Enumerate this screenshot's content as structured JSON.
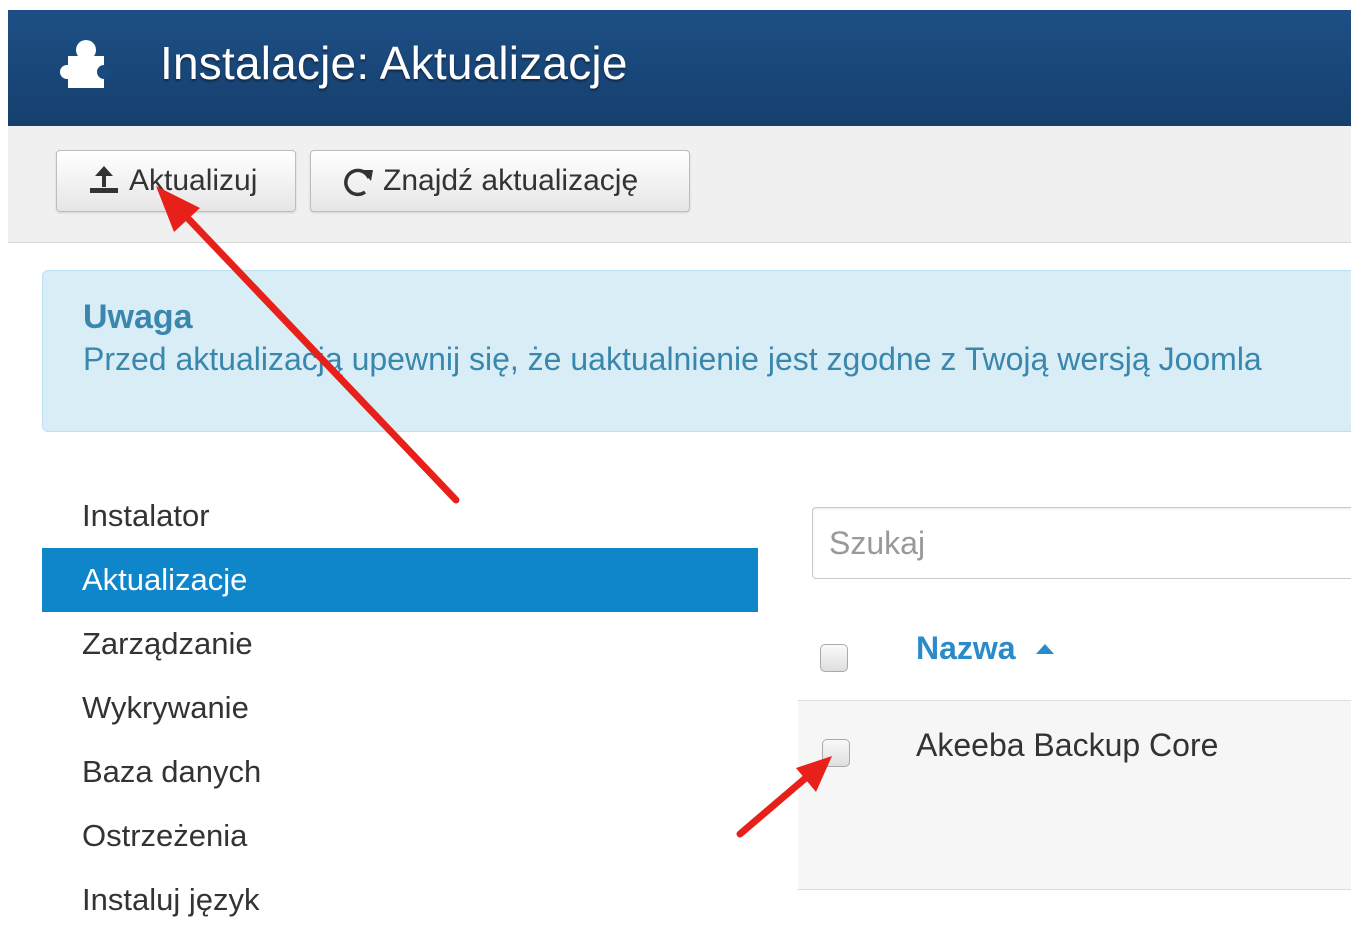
{
  "header": {
    "title": "Instalacje: Aktualizacje",
    "icon": "puzzle-icon",
    "background": "#1a4a7e"
  },
  "toolbar": {
    "update_label": "Aktualizuj",
    "update_icon": "upload-icon",
    "find_label": "Znajdź aktualizację",
    "find_icon": "refresh-icon"
  },
  "alert": {
    "heading": "Uwaga",
    "message": "Przed aktualizacją upewnij się, że uaktualnienie jest zgodne z Twoją wersją Joomla"
  },
  "sidebar": {
    "items": [
      {
        "label": "Instalator",
        "active": false
      },
      {
        "label": "Aktualizacje",
        "active": true
      },
      {
        "label": "Zarządzanie",
        "active": false
      },
      {
        "label": "Wykrywanie",
        "active": false
      },
      {
        "label": "Baza danych",
        "active": false
      },
      {
        "label": "Ostrzeżenia",
        "active": false
      },
      {
        "label": "Instaluj język",
        "active": false
      }
    ]
  },
  "search": {
    "placeholder": "Szukaj"
  },
  "table": {
    "column_name": "Nazwa",
    "sort_icon": "caret-up-icon",
    "rows": [
      {
        "name": "Akeeba Backup Core",
        "checked": false
      }
    ]
  },
  "annotations": {
    "arrow_color": "#e8201a"
  },
  "colors": {
    "accent": "#0f86c9",
    "alert_bg": "#d9edf7",
    "alert_text": "#3a87ad",
    "link": "#2a8bc8"
  }
}
